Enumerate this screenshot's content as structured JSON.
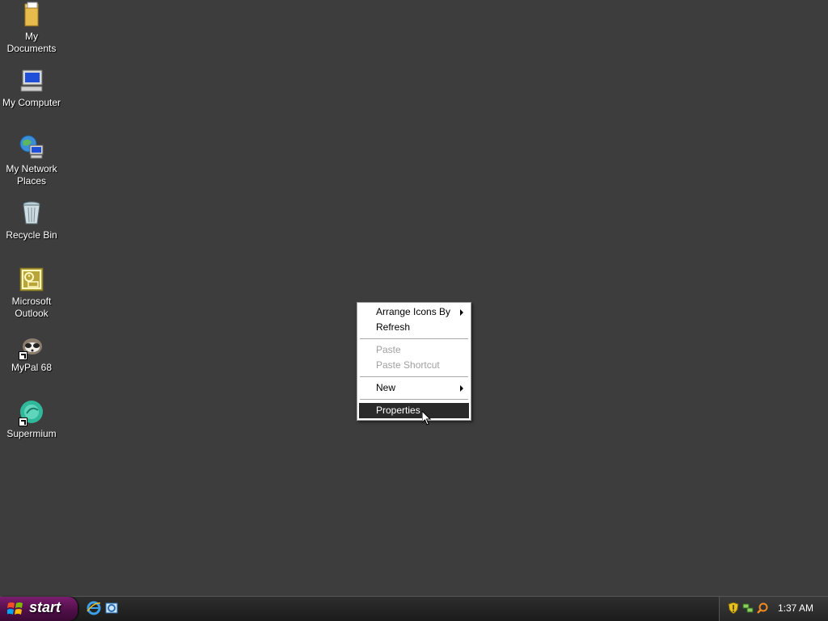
{
  "desktop": {
    "icons": [
      {
        "label": "My Documents",
        "icon": "folder-icon"
      },
      {
        "label": "My Computer",
        "icon": "computer-icon"
      },
      {
        "label": "My Network Places",
        "icon": "network-places-icon"
      },
      {
        "label": "Recycle Bin",
        "icon": "recycle-bin-icon"
      },
      {
        "label": "Microsoft Outlook",
        "icon": "outlook-icon"
      },
      {
        "label": "MyPal 68",
        "icon": "mypal-icon"
      },
      {
        "label": "Supermium",
        "icon": "supermium-icon"
      }
    ]
  },
  "context_menu": {
    "items": [
      {
        "label": "Arrange Icons By",
        "submenu": true,
        "enabled": true
      },
      {
        "label": "Refresh",
        "enabled": true
      },
      {
        "label": "Paste",
        "enabled": false
      },
      {
        "label": "Paste Shortcut",
        "enabled": false
      },
      {
        "label": "New",
        "submenu": true,
        "enabled": true
      },
      {
        "label": "Properties",
        "enabled": true,
        "selected": true
      }
    ]
  },
  "taskbar": {
    "start_label": "start",
    "quick_launch": [
      "internet-explorer-icon",
      "outlook-express-icon"
    ],
    "tray_icons": [
      "security-shield-icon",
      "network-icon",
      "search-icon"
    ],
    "clock": "1:37 AM"
  },
  "colors": {
    "desktop_background": "#3d3d3d",
    "menu_highlight": "#2a2a2a",
    "start_button": "#5a1252"
  }
}
